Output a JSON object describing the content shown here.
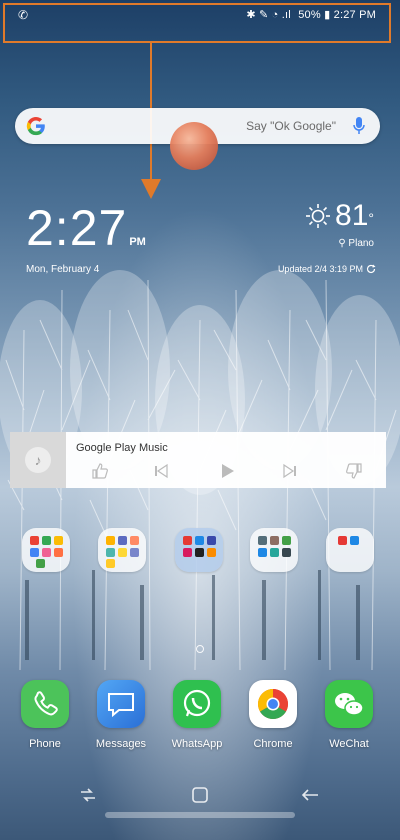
{
  "status_bar": {
    "left_icon": "phone-signal-icon",
    "icons_text": "✱ ✎ ◔ .ıl",
    "battery": "50%",
    "time": "2:27 PM"
  },
  "search": {
    "hint": "Say \"Ok Google\""
  },
  "clock": {
    "time": "2:27",
    "ampm": "PM",
    "date": "Mon, February 4"
  },
  "weather": {
    "temperature": "81",
    "degree": "°",
    "location": "Plano",
    "updated": "Updated 2/4 3:19 PM",
    "icon": "sun-icon"
  },
  "music": {
    "title": "Google Play Music",
    "controls": [
      "thumbs-up-icon",
      "previous-icon",
      "play-icon",
      "next-icon",
      "thumbs-down-icon"
    ]
  },
  "dock": [
    {
      "label": "Phone",
      "icon": "phone-icon",
      "color": "#4cc35a"
    },
    {
      "label": "Messages",
      "icon": "messages-icon",
      "color": "#3a8fe8"
    },
    {
      "label": "WhatsApp",
      "icon": "whatsapp-icon",
      "color": "#2fc04f"
    },
    {
      "label": "Chrome",
      "icon": "chrome-icon",
      "color": "#ffffff"
    },
    {
      "label": "WeChat",
      "icon": "wechat-icon",
      "color": "#3cc54a"
    }
  ],
  "colors": {
    "annotation": "#e07a2a",
    "sky_top": "#1d3f66"
  }
}
